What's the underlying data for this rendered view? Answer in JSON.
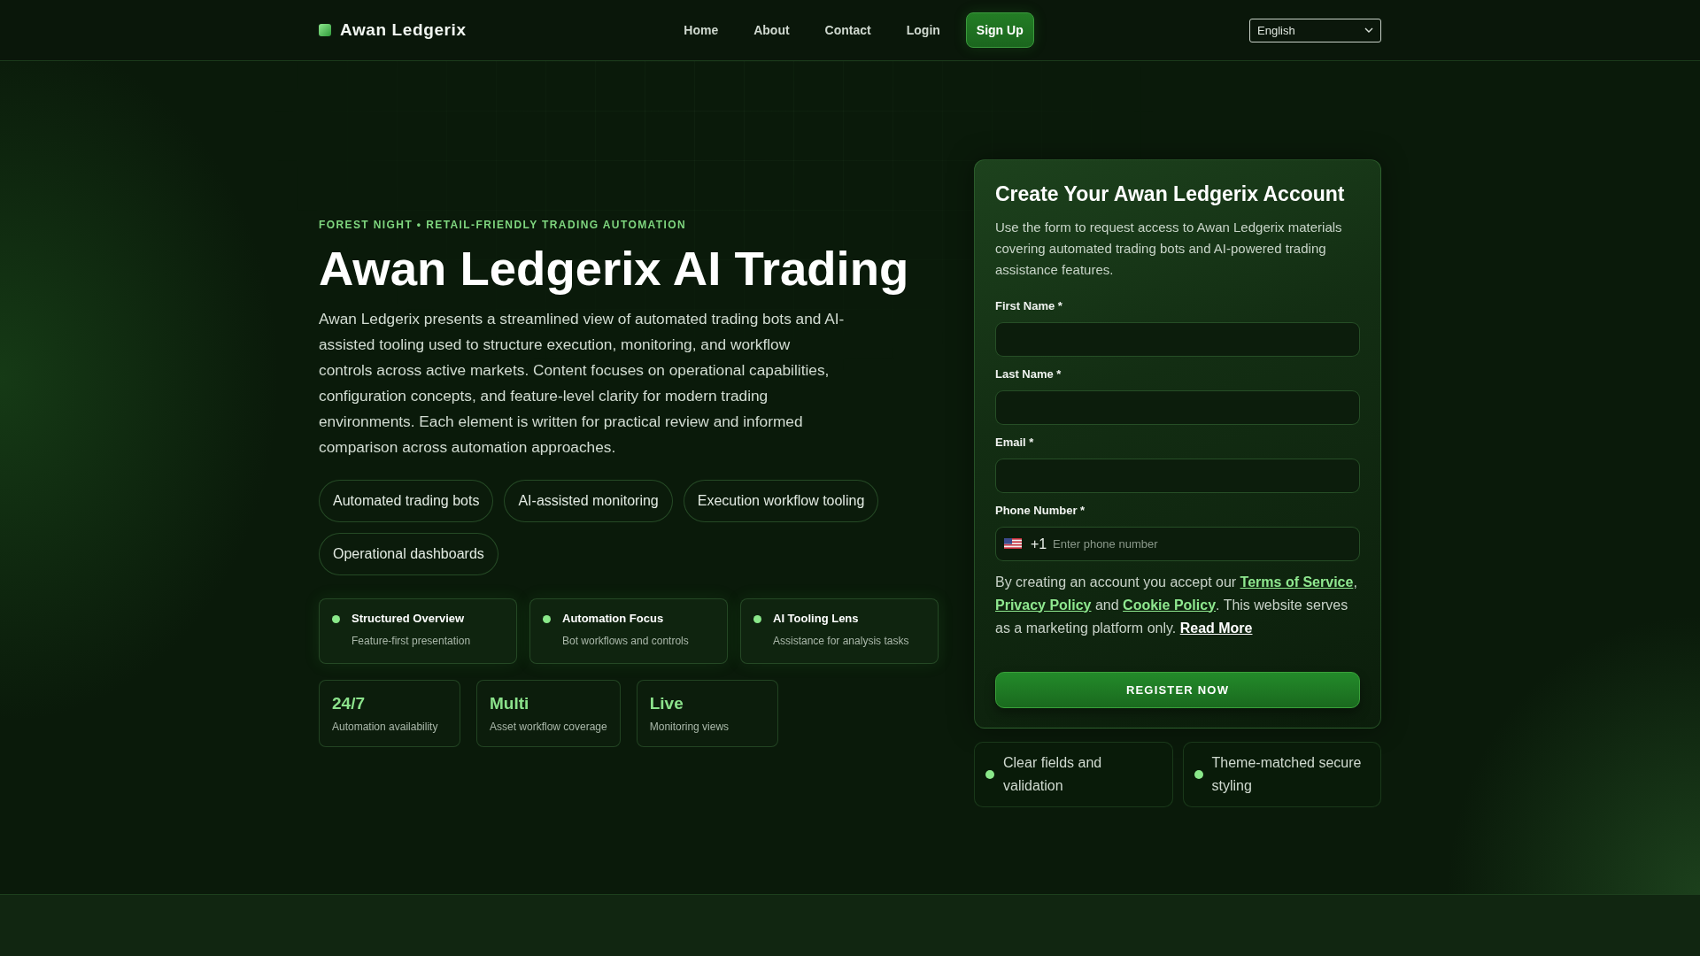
{
  "header": {
    "logo": "Awan Ledgerix",
    "nav": [
      {
        "label": "Home",
        "kind": "link"
      },
      {
        "label": "About",
        "kind": "link"
      },
      {
        "label": "Contact",
        "kind": "link"
      },
      {
        "label": "Login",
        "kind": "link"
      },
      {
        "label": "Sign Up",
        "kind": "button"
      }
    ],
    "language": "English"
  },
  "hero": {
    "eyebrow": "FOREST NIGHT • RETAIL-FRIENDLY TRADING AUTOMATION",
    "title": "Awan Ledgerix AI Trading",
    "description": "Awan Ledgerix presents a streamlined view of automated trading bots and AI-assisted tooling used to structure execution, monitoring, and workflow controls across active markets. Content focuses on operational capabilities, configuration concepts, and feature-level clarity for modern trading environments. Each element is written for practical review and informed comparison across automation approaches.",
    "tags": [
      "Automated trading bots",
      "AI-assisted monitoring",
      "Execution workflow tooling",
      "Operational dashboards"
    ],
    "features": [
      {
        "title": "Structured Overview",
        "subtitle": "Feature-first presentation"
      },
      {
        "title": "Automation Focus",
        "subtitle": "Bot workflows and controls"
      },
      {
        "title": "AI Tooling Lens",
        "subtitle": "Assistance for analysis tasks"
      }
    ],
    "stats": [
      {
        "value": "24/7",
        "label": "Automation availability"
      },
      {
        "value": "Multi",
        "label": "Asset workflow coverage"
      },
      {
        "value": "Live",
        "label": "Monitoring views"
      }
    ]
  },
  "signup_form": {
    "title": "Create Your Awan Ledgerix Account",
    "description": "Use the form to request access to Awan Ledgerix materials covering automated trading bots and AI-powered trading assistance features.",
    "fields": [
      {
        "label": "First Name *",
        "kind": "text"
      },
      {
        "label": "Last Name *",
        "kind": "text"
      },
      {
        "label": "Email *",
        "kind": "email"
      },
      {
        "label": "Phone Number *",
        "kind": "phone",
        "country_code": "+1",
        "placeholder": "Enter phone number"
      }
    ],
    "consent": [
      {
        "text": "By creating an account you accept our ",
        "kind": "text"
      },
      {
        "text": "Terms of Service",
        "kind": "link"
      },
      {
        "text": ", ",
        "kind": "text"
      },
      {
        "text": "Privacy Policy",
        "kind": "link"
      },
      {
        "text": " and ",
        "kind": "text"
      },
      {
        "text": "Cookie Policy",
        "kind": "link"
      },
      {
        "text": ". This website serves as a marketing platform only. ",
        "kind": "text"
      },
      {
        "text": "Read More",
        "kind": "read_more"
      }
    ],
    "submit": "REGISTER NOW"
  },
  "highlights": [
    "Clear fields and validation",
    "Theme-matched secure styling"
  ]
}
